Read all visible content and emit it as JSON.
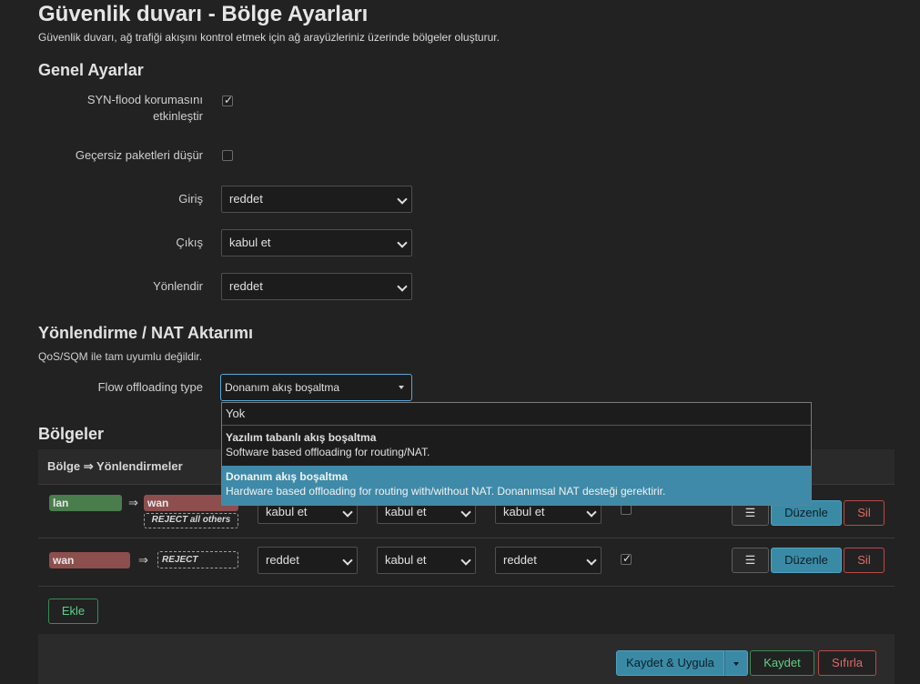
{
  "page": {
    "title": "Güvenlik duvarı - Bölge Ayarları",
    "description": "Güvenlik duvarı, ağ trafiği akışını kontrol etmek için ağ arayüzleriniz üzerinde bölgeler oluşturur."
  },
  "general": {
    "heading": "Genel Ayarlar",
    "syn_flood_label_line1": "SYN-flood korumasını",
    "syn_flood_label_line2": "etkinleştir",
    "syn_flood_checked": true,
    "drop_invalid_label": "Geçersiz paketleri düşür",
    "drop_invalid_checked": false,
    "input_label": "Giriş",
    "input_value": "reddet",
    "output_label": "Çıkış",
    "output_value": "kabul et",
    "forward_label": "Yönlendir",
    "forward_value": "reddet"
  },
  "nat": {
    "heading": "Yönlendirme / NAT Aktarımı",
    "note": "QoS/SQM ile tam uyumlu değildir.",
    "flow_label": "Flow offloading type",
    "flow_value": "Donanım akış boşaltma",
    "options": [
      {
        "title": "Yok",
        "subtitle": ""
      },
      {
        "title": "Yazılım tabanlı akış boşaltma",
        "subtitle": "Software based offloading for routing/NAT."
      },
      {
        "title": "Donanım akış boşaltma",
        "subtitle": "Hardware based offloading for routing with/without NAT. Donanımsal NAT desteği gerektirir."
      }
    ]
  },
  "zones": {
    "heading": "Bölgeler",
    "column_header": "Bölge ⇒ Yönlendirmeler",
    "rows": [
      {
        "name": "lan",
        "arrow": "⇒",
        "target": "wan",
        "target_note": "REJECT all others",
        "input": "kabul et",
        "output": "kabul et",
        "forward": "kabul et",
        "masq": false,
        "menu": "☰",
        "edit": "Düzenle",
        "delete": "Sil"
      },
      {
        "name": "wan",
        "arrow": "⇒",
        "target": "REJECT",
        "input": "reddet",
        "output": "kabul et",
        "forward": "reddet",
        "masq": true,
        "menu": "☰",
        "edit": "Düzenle",
        "delete": "Sil"
      }
    ],
    "add_label": "Ekle"
  },
  "footer": {
    "save_apply": "Kaydet & Uygula",
    "save": "Kaydet",
    "reset": "Sıfırla"
  },
  "colors": {
    "accent": "#3a8aa6",
    "lan": "#4a7d4c",
    "wan": "#8d4e4e",
    "danger": "#b94a4a",
    "success": "#3b8a58"
  }
}
